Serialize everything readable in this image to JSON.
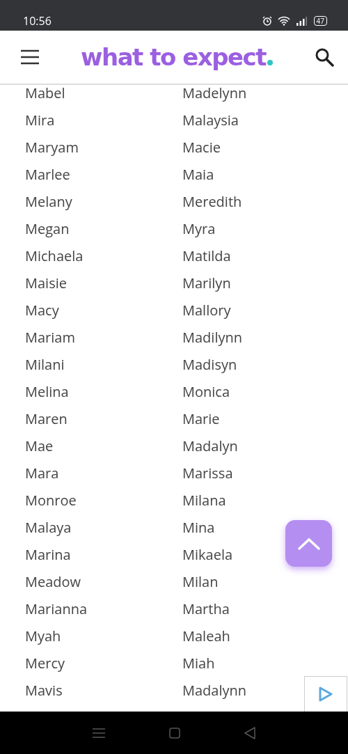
{
  "status_bar": {
    "time": "10:56",
    "battery": "47"
  },
  "header": {
    "logo": "what to expect"
  },
  "names": [
    [
      "Mabel",
      "Madelynn"
    ],
    [
      "Mira",
      "Malaysia"
    ],
    [
      "Maryam",
      "Macie"
    ],
    [
      "Marlee",
      "Maia"
    ],
    [
      "Melany",
      "Meredith"
    ],
    [
      "Megan",
      "Myra"
    ],
    [
      "Michaela",
      "Matilda"
    ],
    [
      "Maisie",
      "Marilyn"
    ],
    [
      "Macy",
      "Mallory"
    ],
    [
      "Mariam",
      "Madilynn"
    ],
    [
      "Milani",
      "Madisyn"
    ],
    [
      "Melina",
      "Monica"
    ],
    [
      "Maren",
      "Marie"
    ],
    [
      "Mae",
      "Madalyn"
    ],
    [
      "Mara",
      "Marissa"
    ],
    [
      "Monroe",
      "Milana"
    ],
    [
      "Malaya",
      "Mina"
    ],
    [
      "Marina",
      "Mikaela"
    ],
    [
      "Meadow",
      "Milan"
    ],
    [
      "Marianna",
      "Martha"
    ],
    [
      "Myah",
      "Maleah"
    ],
    [
      "Mercy",
      "Miah"
    ],
    [
      "Mavis",
      "Madalynn"
    ]
  ]
}
